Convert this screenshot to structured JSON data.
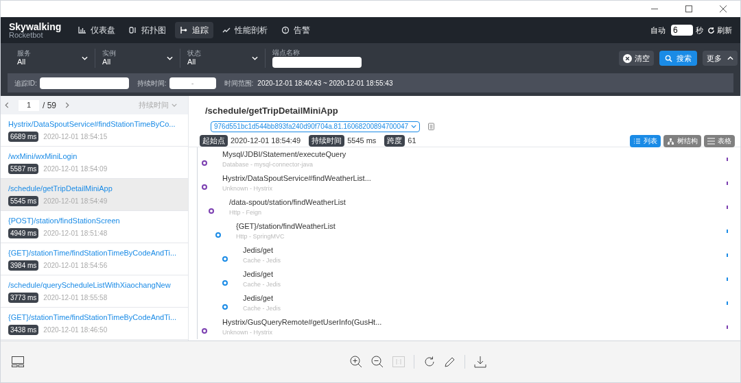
{
  "nav": {
    "logo": "Skywalking",
    "logo_sub": "Rocketbot",
    "tabs": [
      {
        "label": "仪表盘",
        "kind": "chart",
        "selected": false
      },
      {
        "label": "拓扑图",
        "kind": "topology",
        "selected": false
      },
      {
        "label": "追踪",
        "kind": "trace",
        "selected": true
      },
      {
        "label": "性能剖析",
        "kind": "profile",
        "selected": false
      },
      {
        "label": "告警",
        "kind": "alarm",
        "selected": false
      }
    ],
    "auto_label": "自动",
    "interval": "6",
    "unit": "秒",
    "refresh": "刷新"
  },
  "filters": [
    {
      "label": "服务",
      "value": "All",
      "kind": "select"
    },
    {
      "label": "实例",
      "value": "All",
      "kind": "select"
    },
    {
      "label": "状态",
      "value": "All",
      "kind": "select"
    },
    {
      "label": "端点名称",
      "kind": "input"
    }
  ],
  "actions": {
    "clear": "清空",
    "search": "搜索",
    "more": "更多"
  },
  "subfilters": {
    "trace_id_label": "追踪ID:",
    "duration_label": "持续时间:",
    "duration_value": "-",
    "time_range_label": "时间范围:",
    "time_range": "2020-12-01 18:40:43 ~ 2020-12-01 18:55:43"
  },
  "pager": {
    "page": "1",
    "total": "/ 59",
    "sort": "持续时间"
  },
  "traces": [
    {
      "endpoint": "Hystrix/DataSpoutService#findStationTimeByCo...",
      "duration": "6689 ms",
      "start": "2020-12-01 18:54:15",
      "selected": false
    },
    {
      "endpoint": "/wxMini/wxMiniLogin",
      "duration": "5587 ms",
      "start": "2020-12-01 18:54:09",
      "selected": false
    },
    {
      "endpoint": "/schedule/getTripDetailMiniApp",
      "duration": "5545 ms",
      "start": "2020-12-01 18:54:49",
      "selected": true
    },
    {
      "endpoint": "{POST}/station/findStationScreen",
      "duration": "4949 ms",
      "start": "2020-12-01 18:51:48",
      "selected": false
    },
    {
      "endpoint": "{GET}/stationTime/findStationTimeByCodeAndTi...",
      "duration": "3984 ms",
      "start": "2020-12-01 18:54:56",
      "selected": false
    },
    {
      "endpoint": "/schedule/queryScheduleListWithXiaochangNew",
      "duration": "3773 ms",
      "start": "2020-12-01 18:55:58",
      "selected": false
    },
    {
      "endpoint": "{GET}/stationTime/findStationTimeByCodeAndTi...",
      "duration": "3438 ms",
      "start": "2020-12-01 18:46:50",
      "selected": false
    }
  ],
  "detail": {
    "title": "/schedule/getTripDetailMiniApp",
    "trace_id": "976d551bc1d544bb893fa240d90f704a.81.16068200894700047",
    "start_label": "起始点",
    "start": "2020-12-01 18:54:49",
    "duration_label": "持续时间",
    "duration": "5545 ms",
    "spans_label": "跨度",
    "spans": "61",
    "views": [
      {
        "label": "列表",
        "kind": "list",
        "selected": true
      },
      {
        "label": "树结构",
        "kind": "tree",
        "selected": false
      },
      {
        "label": "表格",
        "kind": "table",
        "selected": false
      }
    ]
  },
  "spans": [
    {
      "name": "Mysql/JDBI/Statement/executeQuery",
      "type": "Database - mysql-connector-java",
      "color": "#7b3fb0"
    },
    {
      "name": "Hystrix/DataSpoutService#findWeatherList...",
      "type": "Unknown - Hystrix",
      "color": "#7b3fb0",
      "children": [
        {
          "name": "/data-spout/station/findWeatherList",
          "type": "Http - Feign",
          "color": "#7b3fb0",
          "children": [
            {
              "name": "{GET}/station/findWeatherList",
              "type": "Http - SpringMVC",
              "color": "#1a8be6",
              "children": [
                {
                  "name": "Jedis/get",
                  "type": "Cache - Jedis",
                  "color": "#1a8be6"
                },
                {
                  "name": "Jedis/get",
                  "type": "Cache - Jedis",
                  "color": "#1a8be6"
                },
                {
                  "name": "Jedis/get",
                  "type": "Cache - Jedis",
                  "color": "#1a8be6"
                }
              ]
            }
          ]
        }
      ]
    },
    {
      "name": "Hystrix/GusQueryRemote#getUserInfo(GusHt...",
      "type": "Unknown - Hystrix",
      "color": "#7b3fb0"
    }
  ]
}
